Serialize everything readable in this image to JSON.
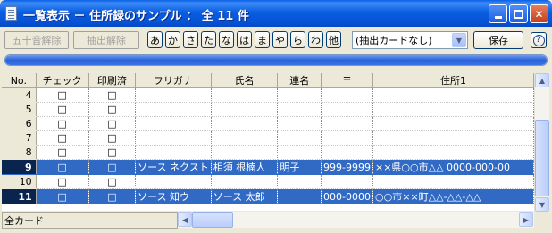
{
  "window": {
    "title": "一覧表示 － 住所録のサンプル ： 全 11 件"
  },
  "toolbar": {
    "gojuon_clear_label": "五十音解除",
    "extract_clear_label": "抽出解除",
    "kana_buttons": [
      "あ",
      "か",
      "さ",
      "た",
      "な",
      "は",
      "ま",
      "や",
      "ら",
      "わ",
      "他"
    ],
    "extract_card_value": "(抽出カードなし)",
    "save_label": "保存",
    "help_label": "?"
  },
  "progress": {
    "value_percent": 100
  },
  "table": {
    "headers": [
      "No.",
      "チェック",
      "印刷済",
      "フリガナ",
      "氏名",
      "連名",
      "〒",
      "住所1"
    ],
    "rows": [
      {
        "no": "4",
        "check": "□",
        "printed": "□",
        "furigana": "",
        "name": "",
        "joint": "",
        "zip": "",
        "address": "",
        "selected": false
      },
      {
        "no": "5",
        "check": "□",
        "printed": "□",
        "furigana": "",
        "name": "",
        "joint": "",
        "zip": "",
        "address": "",
        "selected": false
      },
      {
        "no": "6",
        "check": "□",
        "printed": "□",
        "furigana": "",
        "name": "",
        "joint": "",
        "zip": "",
        "address": "",
        "selected": false
      },
      {
        "no": "7",
        "check": "□",
        "printed": "□",
        "furigana": "",
        "name": "",
        "joint": "",
        "zip": "",
        "address": "",
        "selected": false
      },
      {
        "no": "8",
        "check": "□",
        "printed": "□",
        "furigana": "",
        "name": "",
        "joint": "",
        "zip": "",
        "address": "",
        "selected": false
      },
      {
        "no": "9",
        "check": "□",
        "printed": "□",
        "furigana": "ソース ネクスト",
        "name": "相須 根楠人",
        "joint": "明子",
        "zip": "999-9999",
        "address": "××県○○市△△ 0000-000-00",
        "selected": true
      },
      {
        "no": "10",
        "check": "□",
        "printed": "□",
        "furigana": "",
        "name": "",
        "joint": "",
        "zip": "",
        "address": "",
        "selected": false
      },
      {
        "no": "11",
        "check": "□",
        "printed": "□",
        "furigana": "ソース 知ウ",
        "name": "ソース 太郎",
        "joint": "",
        "zip": "000-0000",
        "address": "○○市××町△△-△△-△△",
        "selected": true
      }
    ]
  },
  "status": {
    "card_filter": "全カード"
  },
  "colors": {
    "title_bar": "#0a5fe4",
    "selection": "#316ac5",
    "window_bg": "#ece9d8"
  }
}
